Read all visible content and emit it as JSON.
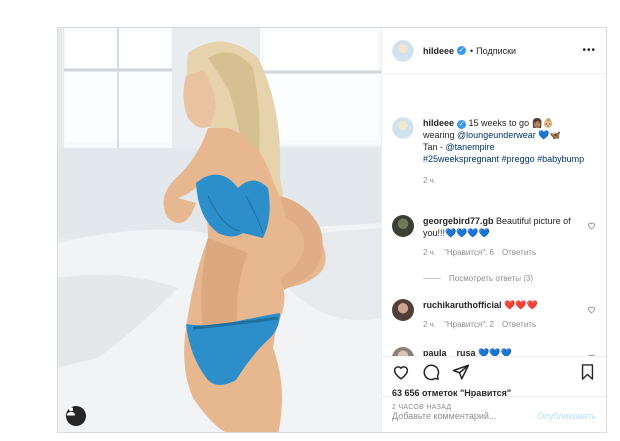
{
  "post": {
    "username": "hildeee",
    "separator": "•",
    "follow_label": "Подписки",
    "more": "•••"
  },
  "caption": {
    "username": "hildeee",
    "line1": "15 weeks to go 👩🏽👶🏼",
    "line2_prefix": "wearing ",
    "mention": "@loungeunderwear",
    "line2_suffix": " 💙🦋",
    "line3_prefix": "Tan - ",
    "tan_mention": "@tanempire",
    "hashtags": "#25weekspregnant #preggo #babybump",
    "time": "2 ч."
  },
  "comments": [
    {
      "username": "georgebird77.gb",
      "text": "Beautiful picture of you!!!💙💙💙💙",
      "time": "2 ч.",
      "likes": "\"Нравится\": 6",
      "reply": "Ответить",
      "view_replies": "Посмотреть ответы (3)"
    },
    {
      "username": "ruchikaruthofficial",
      "text": "❤️❤️❤️",
      "time": "2 ч.",
      "likes": "\"Нравится\": 2",
      "reply": "Ответить"
    },
    {
      "username": "paula__rusa",
      "text": "💙💙💙"
    }
  ],
  "actions": {
    "likes": "63 656 отметок \"Нравится\"",
    "time_ago": "2 ЧАСОВ НАЗАД"
  },
  "add_comment": {
    "placeholder": "Добавьте комментарий...",
    "publish": "Опубликовать"
  },
  "icons": [
    "heart-icon",
    "comment-icon",
    "share-icon",
    "bookmark-icon",
    "user-tag-icon",
    "verified-badge-icon"
  ],
  "colors": {
    "accent": "#3897f0",
    "link": "#00376b",
    "muted": "#8e8e8e",
    "publish_disabled": "#b2dffc",
    "lingerie": "#2c8fc9"
  }
}
